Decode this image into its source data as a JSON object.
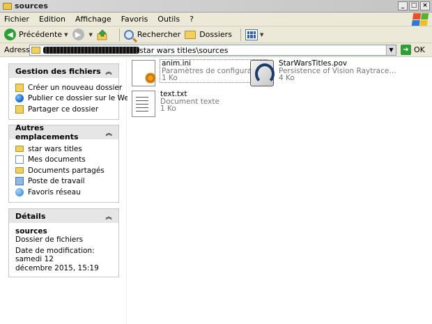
{
  "window": {
    "title": "sources"
  },
  "menu": {
    "items": [
      {
        "label": "Fichier"
      },
      {
        "label": "Edition"
      },
      {
        "label": "Affichage"
      },
      {
        "label": "Favoris"
      },
      {
        "label": "Outils"
      },
      {
        "label": "?"
      }
    ]
  },
  "toolbar": {
    "back_label": "Précédente",
    "search_label": "Rechercher",
    "folders_label": "Dossiers"
  },
  "address": {
    "label": "Adresse",
    "path": "star wars titles\\sources",
    "go_label": "OK"
  },
  "tasks": {
    "header": "Gestion des fichiers",
    "items": [
      {
        "label": "Créer un nouveau dossier",
        "icon": "new-folder-icon"
      },
      {
        "label": "Publier ce dossier sur le Web",
        "icon": "globe-icon"
      },
      {
        "label": "Partager ce dossier",
        "icon": "share-icon"
      }
    ]
  },
  "places": {
    "header": "Autres emplacements",
    "items": [
      {
        "label": "star wars titles",
        "icon": "folder-icon"
      },
      {
        "label": "Mes documents",
        "icon": "documents-icon"
      },
      {
        "label": "Documents partagés",
        "icon": "folder-icon"
      },
      {
        "label": "Poste de travail",
        "icon": "computer-icon"
      },
      {
        "label": "Favoris réseau",
        "icon": "network-icon"
      }
    ]
  },
  "details": {
    "header": "Détails",
    "name": "sources",
    "type": "Dossier de fichiers",
    "modified_line1": "Date de modification: samedi 12",
    "modified_line2": "décembre 2015, 15:19"
  },
  "files": [
    {
      "name": "anim.ini",
      "type": "Paramètres de configuration",
      "size": "1 Ko",
      "icon": "ini-file-icon"
    },
    {
      "name": "StarWarsTitles.pov",
      "type": "Persistence of Vision Raytrace…",
      "size": "4 Ko",
      "icon": "pov-file-icon"
    },
    {
      "name": "text.txt",
      "type": "Document texte",
      "size": "1 Ko",
      "icon": "text-file-icon"
    }
  ]
}
